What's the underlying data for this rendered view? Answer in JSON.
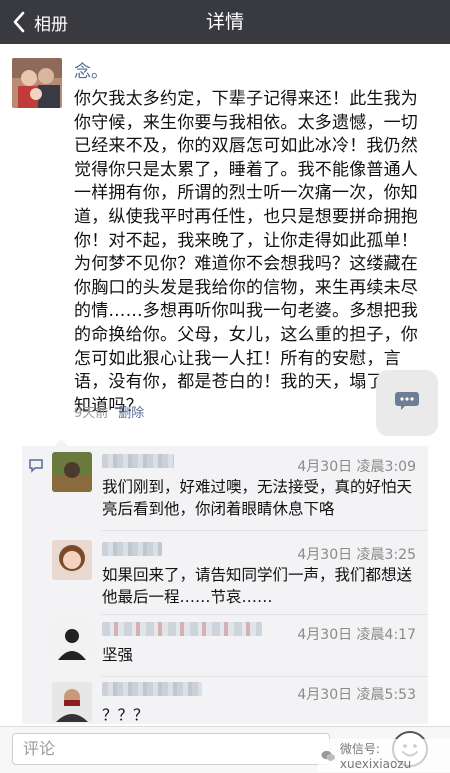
{
  "nav": {
    "back_label": "相册",
    "title": "详情"
  },
  "post": {
    "author": "念。",
    "body": "你欠我太多约定，下辈子记得来还！此生我为你守候，来生你要与我相依。太多遗憾，一切已经来不及，你的双唇怎可如此冰冷！我仍然觉得你只是太累了，睡着了。我不能像普通人一样拥有你，所谓的烈士听一次痛一次，你知道，纵使我平时再任性，也只是想要拼命拥抱你！对不起，我来晚了，让你走得如此孤单！为何梦不见你？难道你不会想我吗？这缕藏在你胸口的头发是我给你的信物，来生再续未尽的情……多想再听你叫我一句老婆。多想把我的命换给你。父母，女儿，这么重的担子，你怎可如此狠心让我一人扛！所有的安慰，言语，没有你，都是苍白的！我的天，塌了！你知道吗？",
    "time_ago": "9天前",
    "delete_label": "删除"
  },
  "comments": [
    {
      "time": "4月30日 凌晨3:09",
      "text": "我们刚到，好难过噢，无法接受，真的好怕天亮后看到他，你闭着眼睛休息下咯"
    },
    {
      "time": "4月30日 凌晨3:25",
      "text": "如果回来了，请告知同学们一声，我们都想送他最后一程……节哀……"
    },
    {
      "time": "4月30日 凌晨4:17",
      "text": "坚强"
    },
    {
      "time": "4月30日 凌晨5:53",
      "text": "？？？"
    }
  ],
  "input": {
    "placeholder": "评论"
  },
  "watermark": "微信号: xuexixiaozu",
  "colors": {
    "navbar": "#393a3f",
    "link": "#576b95",
    "comment_bg": "#f3f3f5"
  }
}
